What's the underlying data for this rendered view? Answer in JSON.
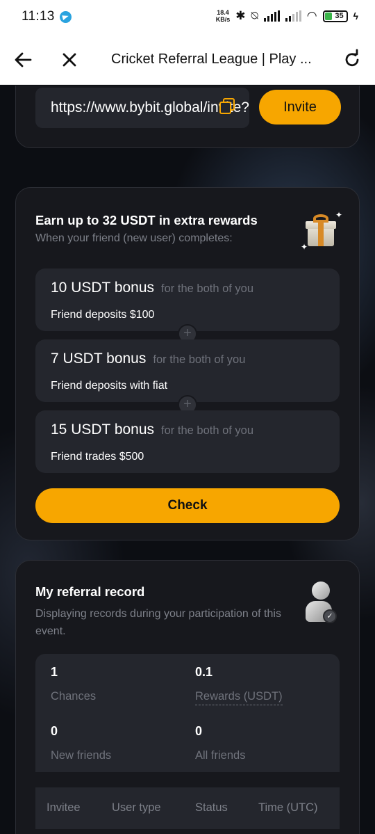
{
  "status_bar": {
    "time": "11:13",
    "speed_value": "18.4",
    "speed_unit": "KB/s",
    "battery": "35"
  },
  "header": {
    "title": "Cricket Referral League | Play ..."
  },
  "invite_card": {
    "link": "https://www.bybit.global/invite?ref=",
    "invite_label": "Invite"
  },
  "rewards_card": {
    "title": "Earn up to 32 USDT in extra rewards",
    "subtitle": "When your friend (new user) completes:",
    "bonuses": [
      {
        "amount": "10 USDT bonus",
        "note": "for the both of you",
        "condition": "Friend deposits $100"
      },
      {
        "amount": "7 USDT bonus",
        "note": "for the both of you",
        "condition": "Friend deposits with fiat"
      },
      {
        "amount": "15 USDT bonus",
        "note": "for the both of you",
        "condition": "Friend trades $500"
      }
    ],
    "check_label": "Check"
  },
  "record_card": {
    "title": "My referral record",
    "subtitle": "Displaying records during your participation of this event.",
    "stats": {
      "chances_value": "1",
      "chances_label": "Chances",
      "rewards_value": "0.1",
      "rewards_label": "Rewards (USDT)",
      "new_friends_value": "0",
      "new_friends_label": "New friends",
      "all_friends_value": "0",
      "all_friends_label": "All friends"
    },
    "table_headers": [
      "Invitee",
      "User type",
      "Status",
      "Time (UTC)"
    ]
  },
  "colors": {
    "accent": "#f7a600",
    "card_bg": "#17181d",
    "inner_bg": "#24262d"
  }
}
